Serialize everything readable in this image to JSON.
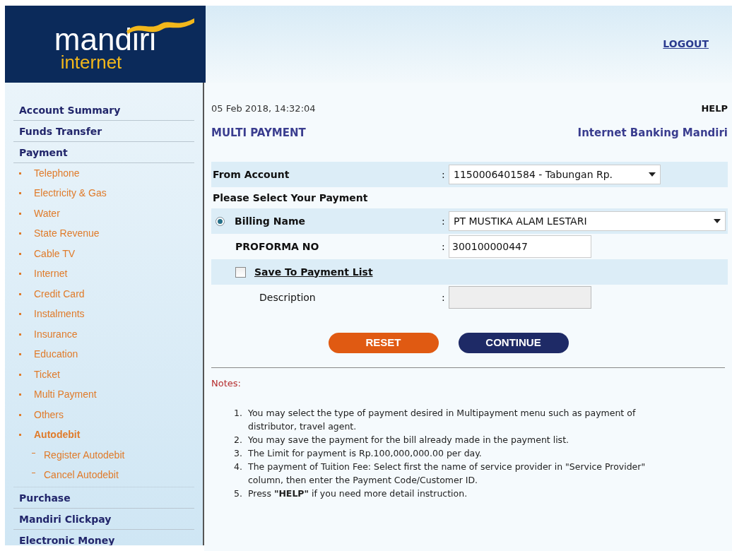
{
  "logo": {
    "word": "mandiri",
    "sub": "internet"
  },
  "header": {
    "logout": "LOGOUT"
  },
  "sidebar": {
    "items": [
      {
        "label": "Account Summary"
      },
      {
        "label": "Funds Transfer"
      },
      {
        "label": "Payment",
        "children": [
          {
            "label": "Telephone",
            "expanded": false
          },
          {
            "label": "Electricity & Gas",
            "expanded": false
          },
          {
            "label": "Water",
            "expanded": false
          },
          {
            "label": "State Revenue",
            "expanded": false
          },
          {
            "label": "Cable TV",
            "expanded": false
          },
          {
            "label": "Internet",
            "expanded": false
          },
          {
            "label": "Credit Card",
            "expanded": false
          },
          {
            "label": "Instalments",
            "expanded": false
          },
          {
            "label": "Insurance",
            "expanded": false
          },
          {
            "label": "Education",
            "expanded": false
          },
          {
            "label": "Ticket",
            "expanded": false
          },
          {
            "label": "Multi Payment",
            "expanded": false
          },
          {
            "label": "Others",
            "expanded": false
          },
          {
            "label": "Autodebit",
            "expanded": true,
            "children": [
              {
                "label": "Register Autodebit"
              },
              {
                "label": "Cancel Autodebit"
              }
            ]
          }
        ]
      },
      {
        "label": "Purchase"
      },
      {
        "label": "Mandiri Clickpay"
      },
      {
        "label": "Electronic Money"
      }
    ]
  },
  "main": {
    "datetime": "05 Feb 2018, 14:32:04",
    "help": "HELP",
    "title": "MULTI PAYMENT",
    "brand": "Internet Banking Mandiri"
  },
  "form": {
    "from_account": {
      "label": "From Account",
      "value": "1150006401584 - Tabungan Rp."
    },
    "section": "Please Select Your Payment",
    "billing_name": {
      "label": "Billing Name",
      "selected": true,
      "value": "PT MUSTIKA ALAM LESTARI"
    },
    "proforma": {
      "label": "PROFORMA NO",
      "value": "300100000447"
    },
    "save": {
      "label": "Save To Payment List",
      "checked": false
    },
    "description": {
      "label": "Description",
      "disabled": true
    },
    "colon": ":"
  },
  "buttons": {
    "reset": "RESET",
    "continue": "CONTINUE"
  },
  "notes": {
    "title": "Notes:",
    "items": [
      {
        "number": "1.",
        "text": "You may select the type of payment desired in Multipayment menu such as payment of distributor, travel agent."
      },
      {
        "number": "2.",
        "text": "You may save the payment for the bill already made in the payment list."
      },
      {
        "number": "3.",
        "text": "The Limit for payment is Rp.100,000,000.00 per day."
      },
      {
        "number": "4.",
        "text": "The payment of Tuition Fee: Select first the name of service provider in \"Service Provider\" column, then enter the Payment Code/Customer ID."
      },
      {
        "number": "5.",
        "text": "Press **\"HELP\"** if you need more detail instruction."
      }
    ]
  }
}
